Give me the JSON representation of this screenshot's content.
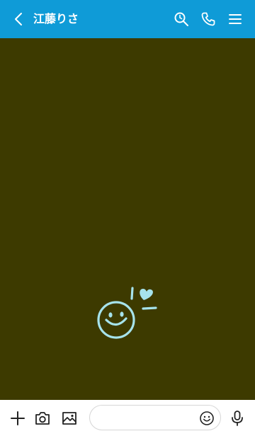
{
  "header": {
    "title": "江藤りさ",
    "background_color": "#0f9bd7",
    "icons": [
      "back-arrow-icon",
      "search-icon",
      "phone-icon",
      "menu-icon"
    ]
  },
  "chat": {
    "background_color": "#3d3a00",
    "decoration": "smiley-with-heart-icon",
    "decoration_color": "#a6e3ec"
  },
  "composer": {
    "message_placeholder": "",
    "icons": [
      "plus-icon",
      "camera-icon",
      "image-icon",
      "emoji-icon",
      "microphone-icon"
    ]
  }
}
